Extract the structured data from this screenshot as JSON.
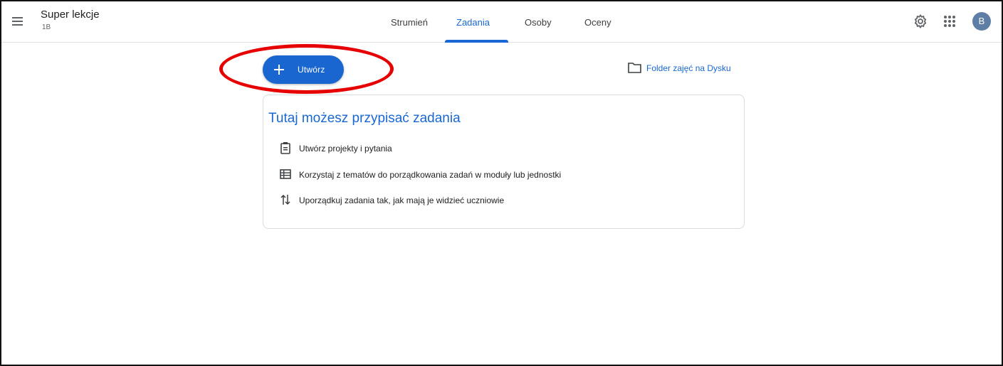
{
  "header": {
    "class_title": "Super lekcje",
    "class_subtitle": "1B",
    "tabs": [
      {
        "label": "Strumień",
        "active": false
      },
      {
        "label": "Zadania",
        "active": true
      },
      {
        "label": "Osoby",
        "active": false
      },
      {
        "label": "Oceny",
        "active": false
      }
    ],
    "avatar_initial": "B",
    "icons": [
      "menu-icon",
      "settings-icon",
      "apps-grid-icon"
    ]
  },
  "toolbar": {
    "create_label": "Utwórz",
    "drive_folder_label": "Folder zajęć na Dysku"
  },
  "empty_state": {
    "title": "Tutaj możesz przypisać zadania",
    "items": [
      {
        "icon": "assignment-icon",
        "text": "Utwórz projekty i pytania"
      },
      {
        "icon": "topic-list-icon",
        "text": "Korzystaj z tematów do porządkowania zadań w moduły lub jednostki"
      },
      {
        "icon": "reorder-arrows-icon",
        "text": "Uporządkuj zadania tak, jak mają je widzieć uczniowie"
      }
    ]
  },
  "colors": {
    "accent": "#1967d2",
    "create_button": "#1a66d0",
    "annotation": "#e60000"
  }
}
